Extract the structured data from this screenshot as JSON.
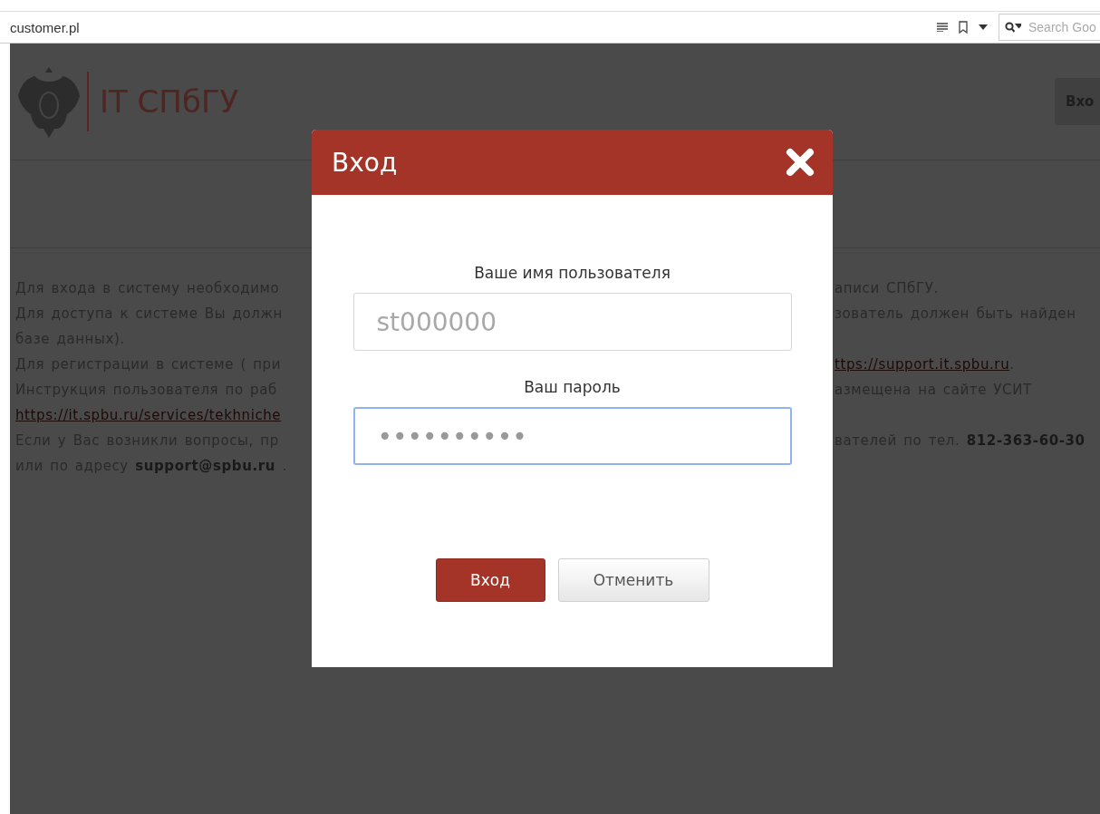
{
  "browser": {
    "url": "customer.pl",
    "search": {
      "placeholder": "Search Goo"
    }
  },
  "header": {
    "brand": "IT СПбГУ",
    "login_button": "Вхо"
  },
  "notice": {
    "lines": [
      {
        "left": [
          {
            "kind": "text",
            "text": "Для входа в систему необходимо"
          }
        ],
        "right": [
          {
            "kind": "text",
            "text": "аписи СПбГУ."
          }
        ]
      },
      {
        "left": [
          {
            "kind": "text",
            "text": "Для доступа к системе Вы должн"
          }
        ],
        "right": [
          {
            "kind": "text",
            "text": "зователь должен быть найден"
          }
        ]
      },
      {
        "left": [
          {
            "kind": "text",
            "text": "базе данных)."
          }
        ]
      },
      {
        "left": [
          {
            "kind": "text",
            "text": "Для регистрации в системе ( при"
          }
        ],
        "right": [
          {
            "kind": "link",
            "text": "ttps://support.it.spbu.ru"
          },
          {
            "kind": "text",
            "text": "."
          }
        ]
      },
      {
        "left": [
          {
            "kind": "text",
            "text": "Инструкция пользователя по раб"
          }
        ],
        "right": [
          {
            "kind": "text",
            "text": "азмещена на сайте УСИТ"
          }
        ]
      },
      {
        "left": [
          {
            "kind": "link",
            "text": "https://it.spbu.ru/services/tekhniche"
          }
        ]
      },
      {
        "left": [
          {
            "kind": "text",
            "text": "Если у Вас возникли вопросы, пр"
          }
        ],
        "right": [
          {
            "kind": "text",
            "text": "вателей по тел. **812-363-60-30**"
          }
        ]
      },
      {
        "left": [
          {
            "kind": "text",
            "text": "или по адресу **support@spbu.ru** ."
          }
        ]
      }
    ]
  },
  "dialog": {
    "title": "Вход",
    "fields": [
      {
        "label": "Ваше имя пользователя",
        "placeholder": "st000000",
        "focused": false
      },
      {
        "label": "Ваш пароль",
        "value": "••••••••••",
        "focused": true
      }
    ],
    "buttons": [
      {
        "kind": "primary",
        "label": "Вход"
      },
      {
        "kind": "secondary",
        "label": "Отменить"
      }
    ]
  }
}
